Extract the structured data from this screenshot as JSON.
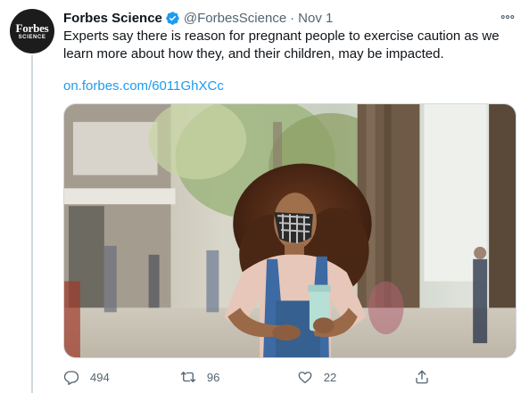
{
  "tweet": {
    "author_name": "Forbes Science",
    "handle": "@ForbesScience",
    "separator": "·",
    "timestamp": "Nov 1",
    "text": "Experts say there is reason for pregnant people to exercise caution as we learn more about how they, and their children, may be impacted.",
    "link": "on.forbes.com/6011GhXCc",
    "avatar": {
      "brand": "Forbes",
      "sub": "SCIENCE"
    }
  },
  "actions": {
    "reply_count": "494",
    "retweet_count": "96",
    "like_count": "22"
  },
  "colors": {
    "link": "#1d9bf0",
    "verified": "#1d9bf0",
    "secondary_text": "#536471"
  },
  "icons": [
    "verified-badge-icon",
    "more-icon",
    "reply-icon",
    "retweet-icon",
    "like-icon",
    "share-icon"
  ]
}
